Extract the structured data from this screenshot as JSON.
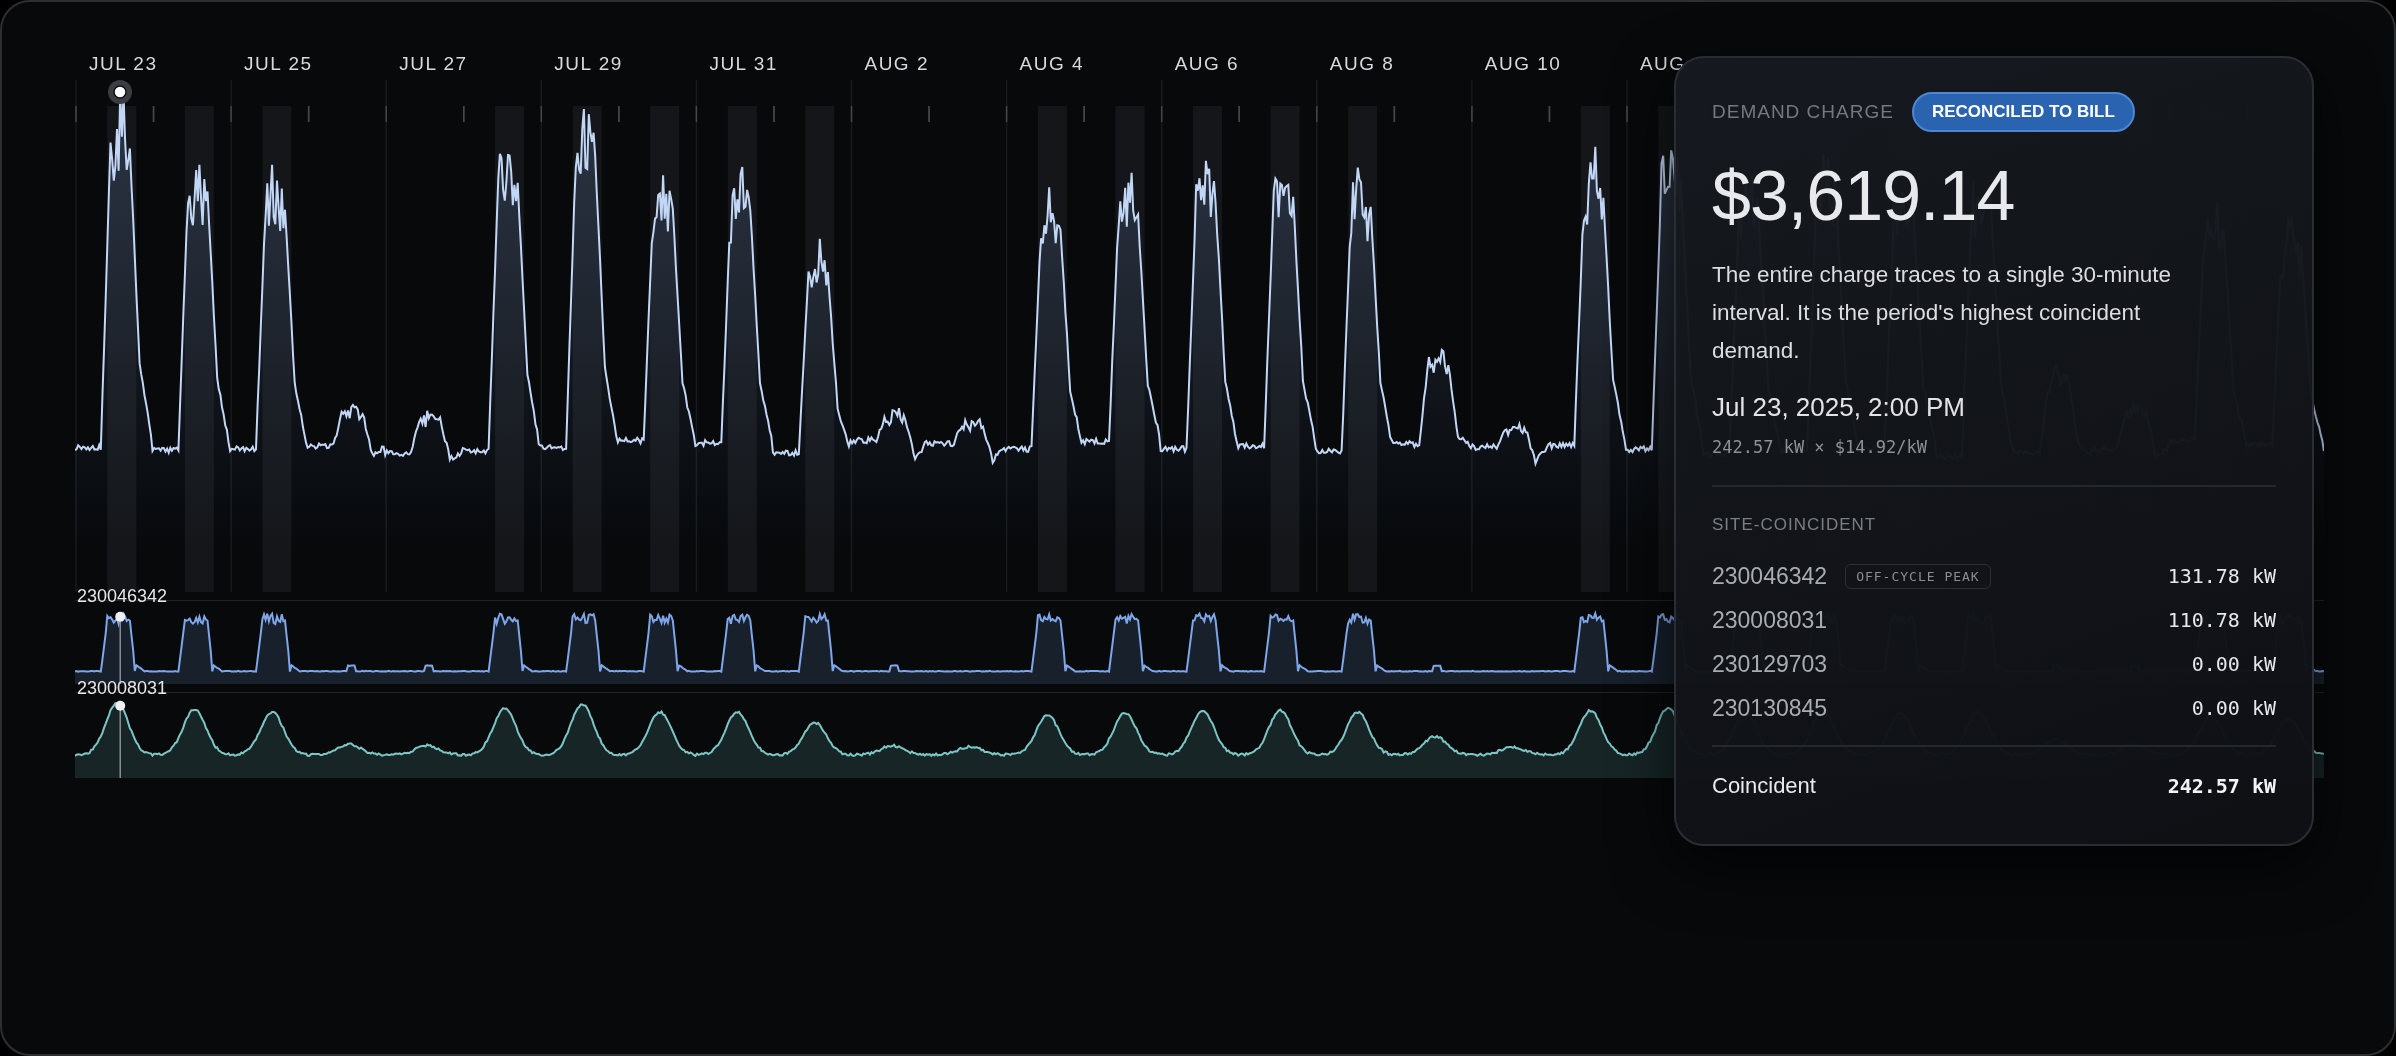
{
  "axis": {
    "labels": [
      "JUL 23",
      "JUL 25",
      "JUL 27",
      "JUL 29",
      "JUL 31",
      "AUG 2",
      "AUG 4",
      "AUG 6",
      "AUG 8",
      "AUG 10",
      "AUG"
    ]
  },
  "strips": [
    {
      "meter": "230046342",
      "kind": "plateau",
      "color": "#7ea6e8"
    },
    {
      "meter": "230008031",
      "kind": "hump",
      "color": "#7cc6c6"
    }
  ],
  "tooltip": {
    "eyebrow": "DEMAND CHARGE",
    "badge": "RECONCILED TO BILL",
    "amount": "$3,619.14",
    "description": "The entire charge traces to a single 30-minute interval. It is the period's highest coincident demand.",
    "timestamp": "Jul 23, 2025, 2:00 PM",
    "formula": "242.57 kW × $14.92/kW",
    "section": "SITE-COINCIDENT",
    "meters": [
      {
        "id": "230046342",
        "tag": "OFF-CYCLE PEAK",
        "value": "131.78 kW"
      },
      {
        "id": "230008031",
        "value": "110.78 kW"
      },
      {
        "id": "230129703",
        "value": "0.00 kW"
      },
      {
        "id": "230130845",
        "value": "0.00 kW"
      }
    ],
    "total": {
      "label": "Coincident",
      "value": "242.57 kW"
    }
  }
}
